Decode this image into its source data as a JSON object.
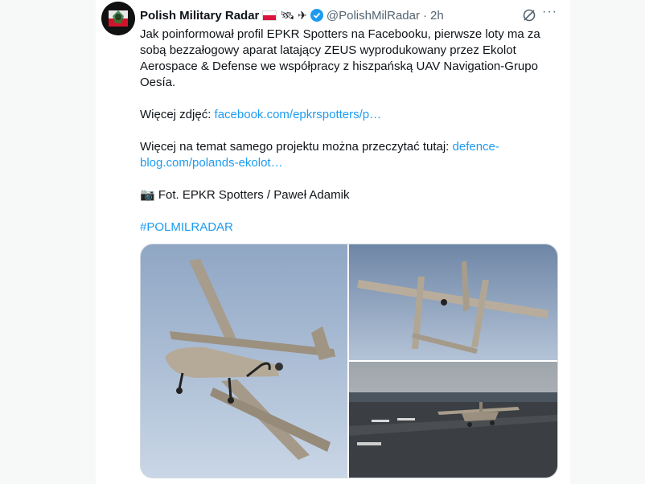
{
  "tweet": {
    "author_name": "Polish Military Radar",
    "emojis": "🛰 ✈",
    "handle": "@PolishMilRadar",
    "separator": "·",
    "time": "2h",
    "paragraph1": "Jak poinformował profil EPKR Spotters na Facebooku, pierwsze loty ma za sobą bezzałogowy aparat latający ZEUS wyprodukowany przez Ekolot Aerospace & Defense we współpracy z hiszpańską UAV Navigation-Grupo Oesía.",
    "more_photos_label": "Więcej zdjęć: ",
    "more_photos_link": "facebook.com/epkrspotters/p…",
    "more_info_label": "Więcej na temat samego projektu można przeczytać tutaj: ",
    "more_info_link": "defence-blog.com/polands-ekolot…",
    "photo_credit": "📷 Fot. EPKR Spotters / Paweł Adamik",
    "hashtag": "#POLMILRADAR"
  },
  "icons": {
    "flag": "poland-flag-icon",
    "satellite": "satellite-icon",
    "airplane": "airplane-icon",
    "verified": "verified-badge-icon",
    "grok": "grok-icon",
    "more": "more-options-icon"
  },
  "colors": {
    "link": "#1d9bf0",
    "text": "#0f1419",
    "secondary": "#536471",
    "verified": "#1d9bf0"
  },
  "media": [
    {
      "alt": "drone-in-flight-side-photo"
    },
    {
      "alt": "drone-overhead-photo"
    },
    {
      "alt": "drone-on-runway-photo"
    }
  ]
}
